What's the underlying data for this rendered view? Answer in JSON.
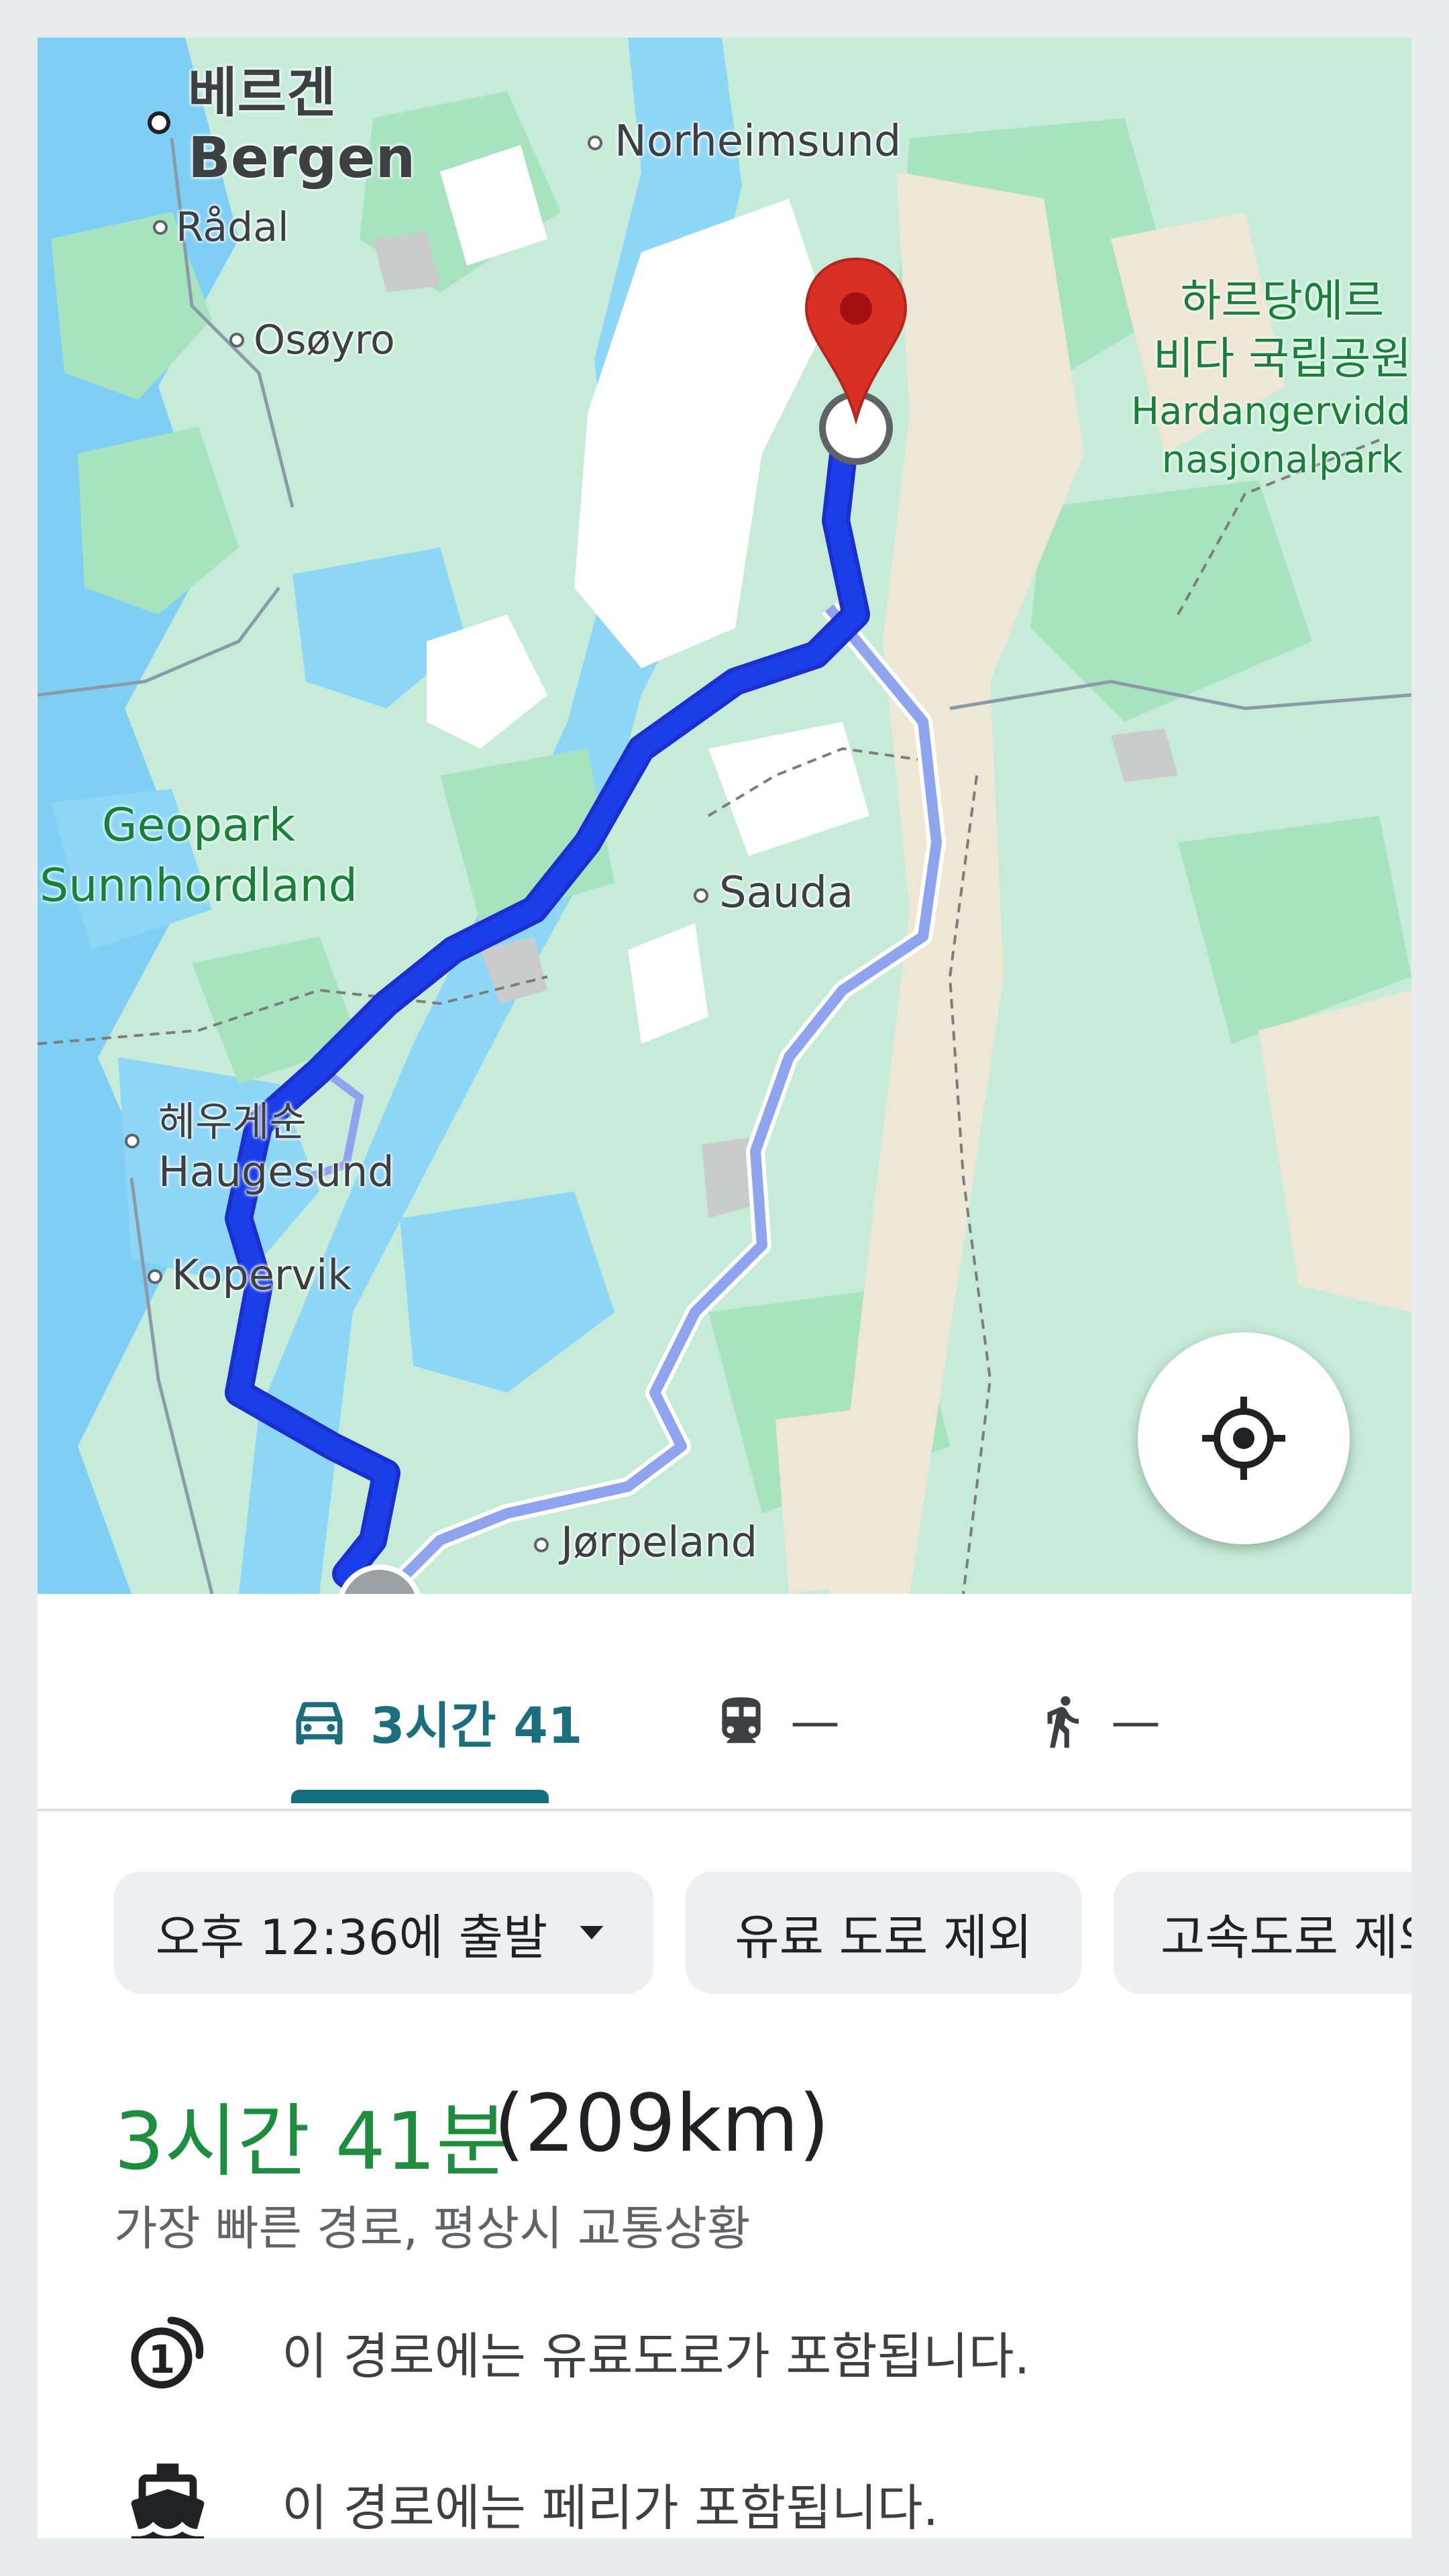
{
  "map": {
    "places": {
      "bergen_ko": "베르겐",
      "bergen": "Bergen",
      "radal": "Rådal",
      "osoyro": "Osøyro",
      "norheimsund": "Norheimsund",
      "sauda": "Sauda",
      "haugesund_ko": "헤우게순",
      "haugesund": "Haugesund",
      "kopervik": "Kopervik",
      "jorpeland": "Jørpeland"
    },
    "park_ko_line1": "하르당에르",
    "park_ko_line2": "비다 국립공원",
    "park_en_line1": "Hardangervidda",
    "park_en_line2": "nasjonalpark",
    "geopark_line1": "Geopark",
    "geopark_line2": "Sunnhordland",
    "destination_pin_color": "#d93025",
    "route_color": "#1a3ee8",
    "alt_route_color": "#8ea4ee",
    "locate_icon": "my-location-icon"
  },
  "tabs": [
    {
      "icon": "car-icon",
      "label": "3시간 41",
      "active": true
    },
    {
      "icon": "train-icon",
      "label": "—",
      "active": false
    },
    {
      "icon": "walking-icon",
      "label": "—",
      "active": false
    }
  ],
  "chips": {
    "depart": "오후 12:36에 출발",
    "avoid_tolls": "유료 도로 제외",
    "avoid_highways": "고속도로 제외"
  },
  "summary": {
    "duration": "3시간 41분",
    "distance": "(209km)",
    "subtitle": "가장 빠른 경로, 평상시 교통상황"
  },
  "notes": [
    {
      "icon": "toll-icon",
      "text": "이 경로에는 유료도로가 포함됩니다."
    },
    {
      "icon": "ferry-icon",
      "text": "이 경로에는 페리가 포함됩니다."
    }
  ]
}
